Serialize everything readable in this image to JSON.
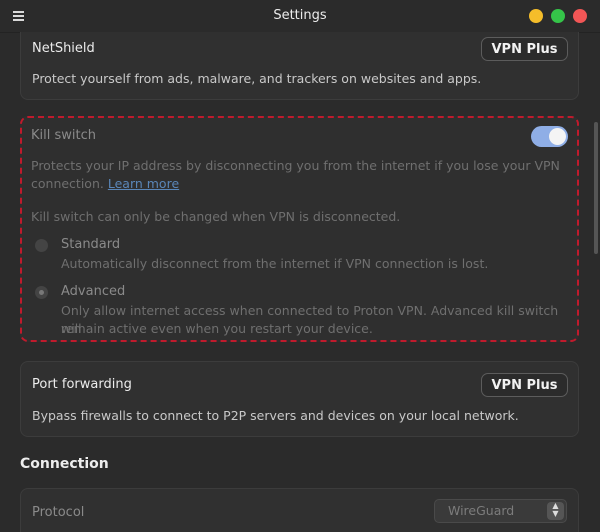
{
  "window": {
    "title": "Settings"
  },
  "netshield": {
    "title": "NetShield",
    "badge": "VPN Plus",
    "description": "Protect yourself from ads, malware, and trackers on websites and apps."
  },
  "killswitch": {
    "title": "Kill switch",
    "enabled": true,
    "desc_line1": "Protects your IP address by disconnecting you from the internet if you lose your VPN",
    "desc_line2_prefix": "connection.",
    "learn_more": "Learn more",
    "notice": "Kill switch can only be changed when VPN is disconnected.",
    "options": [
      {
        "label": "Standard",
        "line1": "Automatically disconnect from the internet if VPN connection is lost.",
        "line2": "",
        "selected": false
      },
      {
        "label": "Advanced",
        "line1": "Only allow internet access when connected to Proton VPN. Advanced kill switch will",
        "line2": "remain active even when you restart your device.",
        "selected": true
      }
    ]
  },
  "port_forwarding": {
    "title": "Port forwarding",
    "badge": "VPN Plus",
    "description": "Bypass firewalls to connect to P2P servers and devices on your local network."
  },
  "connection": {
    "section_title": "Connection",
    "protocol_label": "Protocol",
    "protocol_value": "WireGuard"
  },
  "colors": {
    "accent_toggle": "#8faee6",
    "highlight_border": "#c01a2c",
    "link": "#5a86b8"
  }
}
